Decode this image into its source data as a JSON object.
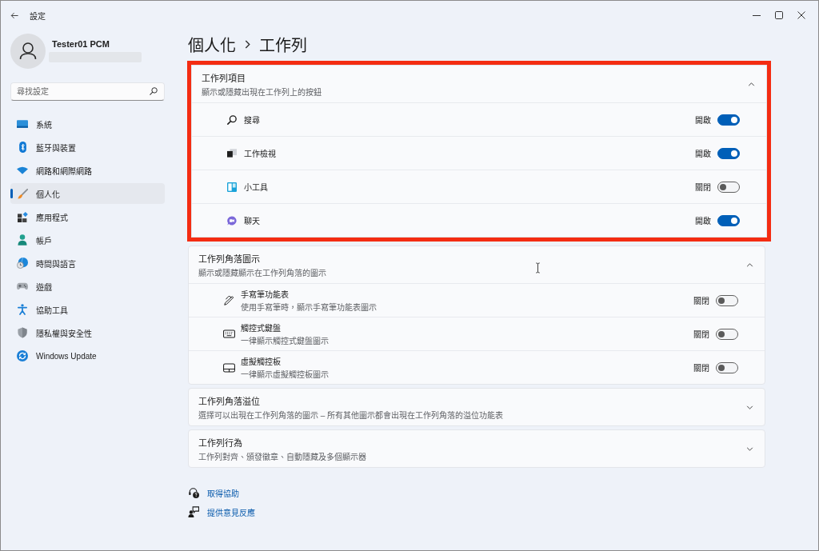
{
  "window": {
    "title": "設定"
  },
  "account": {
    "name": "Tester01 PCM"
  },
  "search": {
    "placeholder": "尋找設定"
  },
  "sidebar": {
    "items": [
      {
        "label": "系統",
        "selected": false
      },
      {
        "label": "藍牙與裝置",
        "selected": false
      },
      {
        "label": "網路和網際網路",
        "selected": false
      },
      {
        "label": "個人化",
        "selected": true
      },
      {
        "label": "應用程式",
        "selected": false
      },
      {
        "label": "帳戶",
        "selected": false
      },
      {
        "label": "時間與語言",
        "selected": false
      },
      {
        "label": "遊戲",
        "selected": false
      },
      {
        "label": "協助工具",
        "selected": false
      },
      {
        "label": "隱私權與安全性",
        "selected": false
      },
      {
        "label": "Windows Update",
        "selected": false
      }
    ]
  },
  "breadcrumb": [
    "個人化",
    "工作列"
  ],
  "sections": [
    {
      "title": "工作列項目",
      "subtitle": "顯示或隱藏出現在工作列上的按鈕",
      "expanded": true,
      "highlighted": true,
      "items": [
        {
          "label": "搜尋",
          "status": "開啟",
          "on": true
        },
        {
          "label": "工作檢視",
          "status": "開啟",
          "on": true
        },
        {
          "label": "小工具",
          "status": "關閉",
          "on": false
        },
        {
          "label": "聊天",
          "status": "開啟",
          "on": true
        }
      ]
    },
    {
      "title": "工作列角落圖示",
      "subtitle": "顯示或隱藏顯示在工作列角落的圖示",
      "expanded": true,
      "highlighted": false,
      "items": [
        {
          "label": "手寫筆功能表",
          "description": "使用手寫筆時，顯示手寫筆功能表圖示",
          "status": "關閉",
          "on": false
        },
        {
          "label": "觸控式鍵盤",
          "description": "一律顯示觸控式鍵盤圖示",
          "status": "關閉",
          "on": false
        },
        {
          "label": "虛擬觸控板",
          "description": "一律顯示虛擬觸控板圖示",
          "status": "關閉",
          "on": false
        }
      ]
    },
    {
      "title": "工作列角落溢位",
      "subtitle": "選擇可以出現在工作列角落的圖示 – 所有其他圖示都會出現在工作列角落的溢位功能表",
      "expanded": false,
      "highlighted": false
    },
    {
      "title": "工作列行為",
      "subtitle": "工作列對齊、頒發徽章、自動隱藏及多個顯示器",
      "expanded": false,
      "highlighted": false
    }
  ],
  "links": [
    "取得協助",
    "提供意見反應"
  ]
}
